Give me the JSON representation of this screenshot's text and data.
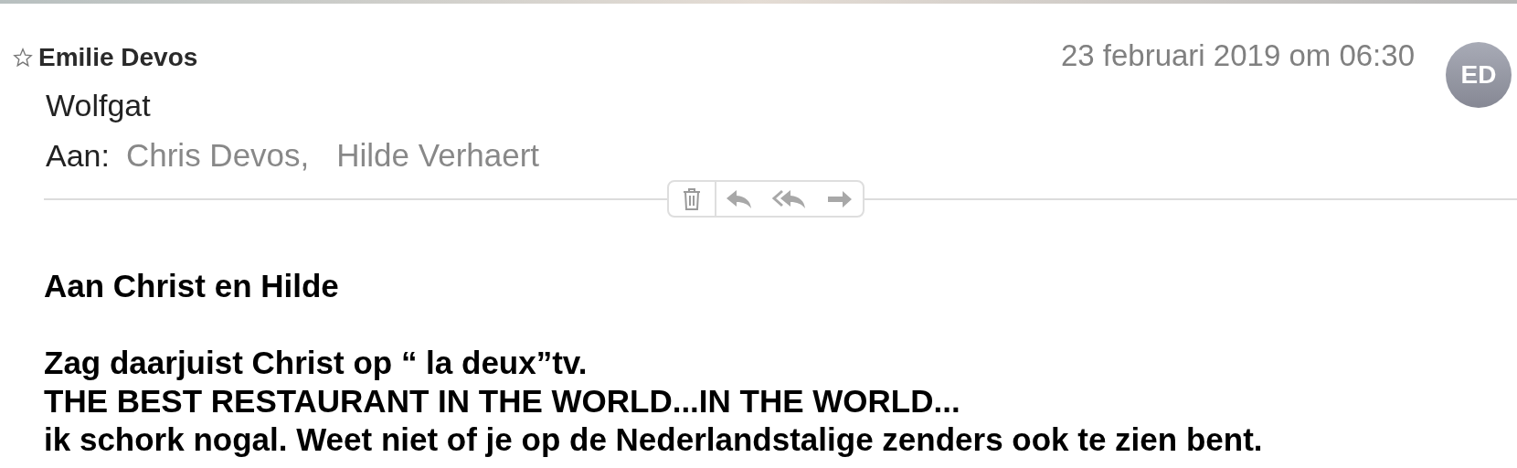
{
  "message": {
    "sender": "Emilie Devos",
    "flagged": false,
    "date": "23 februari 2019 om 06:30",
    "avatar": "ED",
    "subject": "Wolfgat",
    "to_label": "Aan:",
    "recipients": [
      "Chris Devos,",
      "Hilde Verhaert"
    ]
  },
  "toolbar": [
    {
      "kind": "delete"
    },
    {
      "kind": "reply"
    },
    {
      "kind": "reply-all"
    },
    {
      "kind": "forward"
    }
  ],
  "body": {
    "greeting": "Aan Christ en Hilde",
    "lines": [
      "Zag daarjuist Christ op “ la deux”tv.",
      "THE BEST RESTAURANT IN THE WORLD...IN THE WORLD...",
      "ik schork nogal. Weet niet of je op de Nederlandstalige zenders ook te zien bent."
    ]
  }
}
